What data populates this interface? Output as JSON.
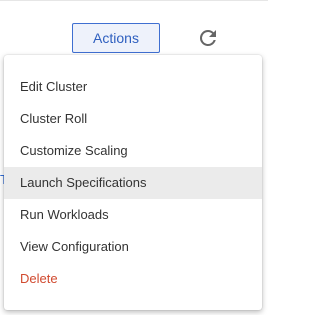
{
  "toolbar": {
    "actions_label": "Actions",
    "refresh_icon": "refresh-icon"
  },
  "background": {
    "tab_letter": "T"
  },
  "menu": {
    "items": [
      {
        "label": "Edit Cluster",
        "state": "normal"
      },
      {
        "label": "Cluster Roll",
        "state": "normal"
      },
      {
        "label": "Customize Scaling",
        "state": "normal"
      },
      {
        "label": "Launch Specifications",
        "state": "hovered"
      },
      {
        "label": "Run Workloads",
        "state": "normal"
      },
      {
        "label": "View Configuration",
        "state": "normal"
      },
      {
        "label": "Delete",
        "state": "danger"
      }
    ]
  },
  "colors": {
    "accent": "#2e5fbf",
    "danger": "#d14a2f",
    "hover": "#ebebeb"
  }
}
